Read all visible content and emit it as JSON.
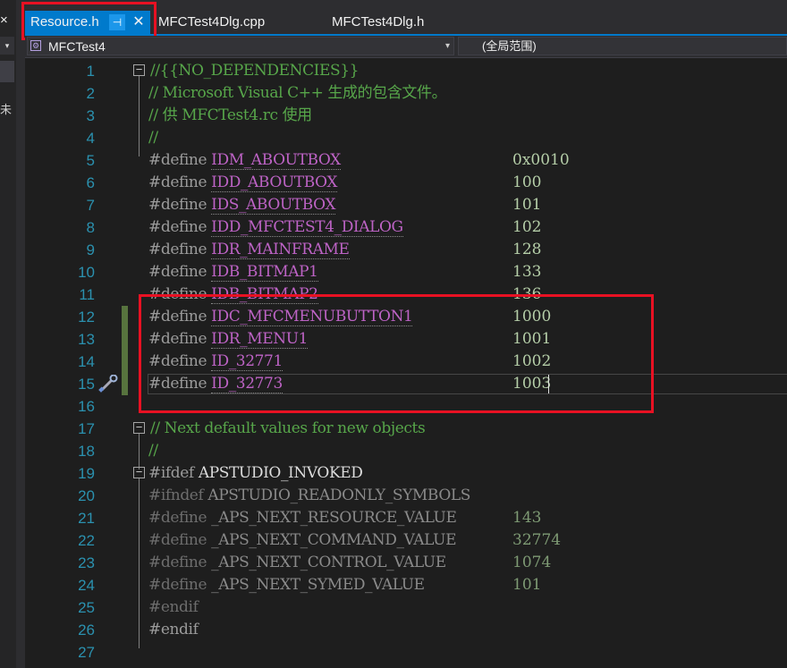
{
  "left_panel": {
    "close_glyph": "×",
    "dropdown_glyph": "▾",
    "fragment": "未"
  },
  "tabs": [
    {
      "label": "Resource.h",
      "active": true,
      "pin_icon": "pin-icon",
      "close_icon": "close-icon"
    },
    {
      "label": "MFCTest4Dlg.cpp",
      "active": false
    },
    {
      "label": "MFCTest4Dlg.h",
      "active": false
    }
  ],
  "navbar": {
    "project": "MFCTest4",
    "project_icon": "class-icon",
    "dropdown_glyph": "▾",
    "scope": "(全局范围)"
  },
  "editor": {
    "current_line": 15,
    "lines": [
      {
        "n": "1",
        "code": "//{{NO_DEPENDENCIES}}",
        "kind": "comment",
        "fold": "⊟"
      },
      {
        "n": "2",
        "code": "// Microsoft Visual C++ 生成的包含文件。",
        "kind": "comment"
      },
      {
        "n": "3",
        "code": "// 供 MFCTest4.rc 使用",
        "kind": "comment"
      },
      {
        "n": "4",
        "code": "//",
        "kind": "comment"
      },
      {
        "n": "5",
        "kw": "#define",
        "id": "IDM_ABOUTBOX",
        "val": "0x0010"
      },
      {
        "n": "6",
        "kw": "#define",
        "id": "IDD_ABOUTBOX",
        "val": "100"
      },
      {
        "n": "7",
        "kw": "#define",
        "id": "IDS_ABOUTBOX",
        "val": "101"
      },
      {
        "n": "8",
        "kw": "#define",
        "id": "IDD_MFCTEST4_DIALOG",
        "val": "102"
      },
      {
        "n": "9",
        "kw": "#define",
        "id": "IDR_MAINFRAME",
        "val": "128"
      },
      {
        "n": "10",
        "kw": "#define",
        "id": "IDB_BITMAP1",
        "val": "133"
      },
      {
        "n": "11",
        "kw": "#define",
        "id": "IDB_BITMAP2",
        "val": "136"
      },
      {
        "n": "12",
        "kw": "#define",
        "id": "IDC_MFCMENUBUTTON1",
        "val": "1000",
        "changed": true
      },
      {
        "n": "13",
        "kw": "#define",
        "id": "IDR_MENU1",
        "val": "1001",
        "changed": true
      },
      {
        "n": "14",
        "kw": "#define",
        "id": "ID_32771",
        "val": "1002",
        "changed": true
      },
      {
        "n": "15",
        "kw": "#define",
        "id": "ID_32773",
        "val": "1003",
        "changed": true,
        "gutter_icon": "screwdriver-icon"
      },
      {
        "n": "16",
        "code": ""
      },
      {
        "n": "17",
        "code": "// Next default values for new objects",
        "kind": "comment",
        "fold": "⊟"
      },
      {
        "n": "18",
        "code": "//",
        "kind": "comment"
      },
      {
        "n": "19",
        "kw": "#ifdef",
        "id": "APSTUDIO_INVOKED",
        "kind": "ifdef",
        "fold": "⊟"
      },
      {
        "n": "20",
        "kw": "#ifndef",
        "id": "APSTUDIO_READONLY_SYMBOLS",
        "kind": "inactive"
      },
      {
        "n": "21",
        "kw": "#define",
        "id": "_APS_NEXT_RESOURCE_VALUE",
        "val": "143",
        "kind": "inactive"
      },
      {
        "n": "22",
        "kw": "#define",
        "id": "_APS_NEXT_COMMAND_VALUE",
        "val": "32774",
        "kind": "inactive"
      },
      {
        "n": "23",
        "kw": "#define",
        "id": "_APS_NEXT_CONTROL_VALUE",
        "val": "1074",
        "kind": "inactive"
      },
      {
        "n": "24",
        "kw": "#define",
        "id": "_APS_NEXT_SYMED_VALUE",
        "val": "101",
        "kind": "inactive"
      },
      {
        "n": "25",
        "kw": "#endif",
        "kind": "inactive"
      },
      {
        "n": "26",
        "kw": "#endif",
        "kind": "endif"
      },
      {
        "n": "27",
        "code": ""
      }
    ]
  }
}
